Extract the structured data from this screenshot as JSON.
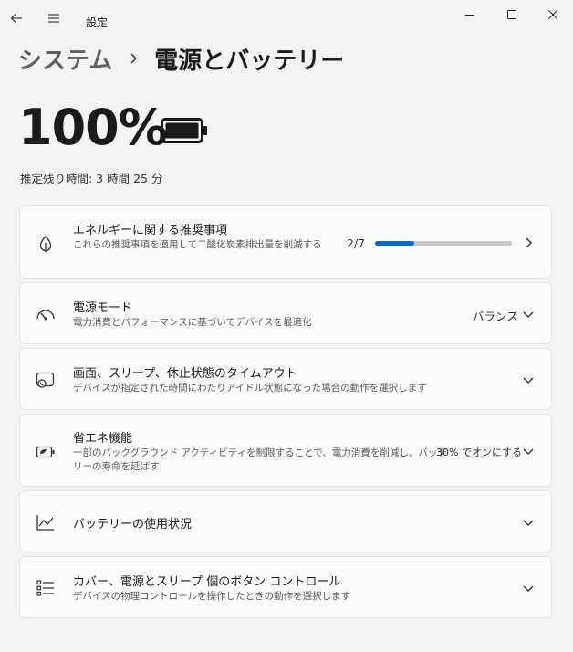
{
  "window": {
    "app_title": "設定"
  },
  "breadcrumb": {
    "parent": "システム",
    "separator": "›",
    "current": "電源とバッテリー"
  },
  "battery": {
    "percent_label": "100%",
    "level": 1.0,
    "remaining": "推定残り時間: 3 時間 25 分"
  },
  "cards": {
    "energy": {
      "title": "エネルギーに関する推奨事項",
      "subtitle": "これらの推奨事項を適用して二酸化炭素排出量を削減する",
      "progress_text": "2/7",
      "progress": 0.2857,
      "icon": "leaf-icon"
    },
    "power_mode": {
      "title": "電源モード",
      "subtitle": "電力消費とパフォーマンスに基づいてデバイスを最適化",
      "value": "バランス",
      "icon": "speedometer-icon"
    },
    "screen_sleep": {
      "title": "画面、スリープ、休止状態のタイムアウト",
      "subtitle": "デバイスが指定された時間にわたりアイドル状態になった場合の動作を選択します",
      "icon": "screen-sleep-icon"
    },
    "energy_saver": {
      "title": "省エネ機能",
      "subtitle": "一部のバックグラウンド アクティビティを制限することで、電力消費を削減し、バッテリーの寿命を延ばす",
      "value": "30% でオンにする",
      "icon": "battery-saver-icon"
    },
    "usage": {
      "title": "バッテリーの使用状況",
      "icon": "chart-icon"
    },
    "lid": {
      "title": "カバー、電源とスリープ 個のボタン コントロール",
      "subtitle": "デバイスの物理コントロールを操作したときの動作を選択します",
      "icon": "list-settings-icon"
    }
  },
  "colors": {
    "accent": "#1565c0",
    "background": "#f3f3f3",
    "card": "#fbfbfb"
  }
}
